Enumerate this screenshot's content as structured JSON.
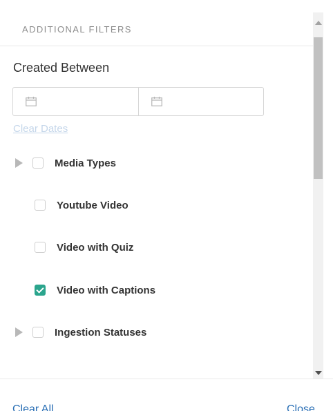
{
  "header": {
    "title": "ADDITIONAL FILTERS"
  },
  "created_between": {
    "label": "Created Between",
    "start_icon": "calendar-icon",
    "end_icon": "calendar-icon",
    "clear_dates": "Clear Dates"
  },
  "filters": [
    {
      "label": "Media Types",
      "expandable": true,
      "checked": false
    },
    {
      "label": "Youtube Video",
      "expandable": false,
      "checked": false
    },
    {
      "label": "Video with Quiz",
      "expandable": false,
      "checked": false
    },
    {
      "label": "Video with Captions",
      "expandable": false,
      "checked": true
    },
    {
      "label": "Ingestion Statuses",
      "expandable": true,
      "checked": false
    }
  ],
  "footer": {
    "clear_all": "Clear All",
    "close": "Close"
  },
  "colors": {
    "accent_checked": "#2ba58d",
    "link": "#2a6fb5",
    "disabled_link": "#c4d6ea"
  }
}
